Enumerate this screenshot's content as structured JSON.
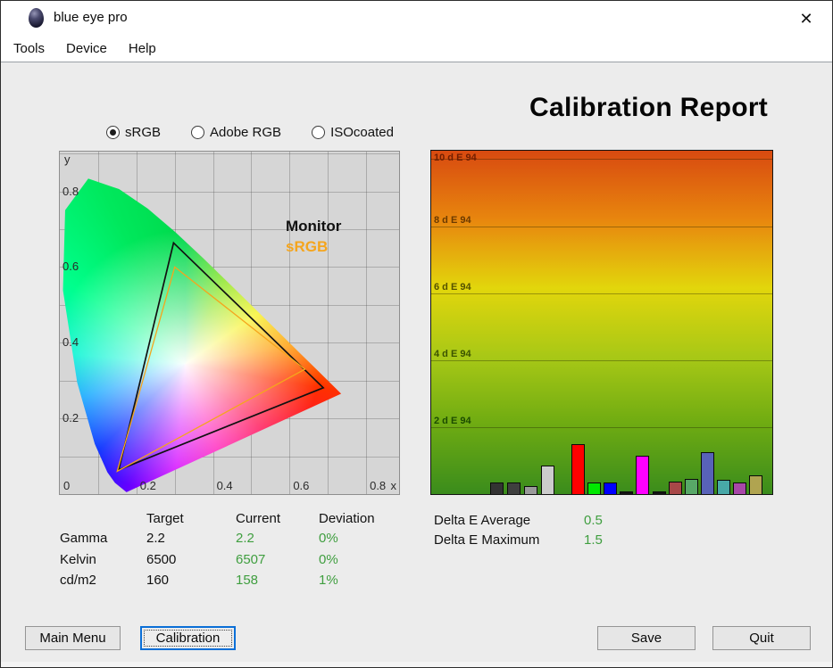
{
  "window": {
    "title": "blue eye pro",
    "close_symbol": "✕"
  },
  "menu": [
    "Tools",
    "Device",
    "Help"
  ],
  "report_title": "Calibration Report",
  "gamut_options": [
    {
      "label": "sRGB",
      "selected": true
    },
    {
      "label": "Adobe RGB",
      "selected": false
    },
    {
      "label": "ISOcoated",
      "selected": false
    }
  ],
  "cie_chart": {
    "x_axis": {
      "label": "x",
      "ticks": [
        "0",
        "0.2",
        "0.4",
        "0.6",
        "0.8"
      ],
      "max": 0.886
    },
    "y_axis": {
      "label": "y",
      "ticks": [
        "0.2",
        "0.4",
        "0.6",
        "0.8"
      ],
      "max": 0.905
    },
    "grid_step": 0.1,
    "legend": [
      {
        "label": "Monitor",
        "color": "#111111"
      },
      {
        "label": "sRGB",
        "color": "#f5a51d"
      }
    ],
    "triangles": [
      {
        "name": "Monitor",
        "color": "#111111",
        "stroke": 1.7,
        "points": [
          [
            0.297,
            0.664
          ],
          [
            0.688,
            0.281
          ],
          [
            0.154,
            0.064
          ]
        ]
      },
      {
        "name": "sRGB",
        "color": "#f5a51d",
        "stroke": 1.3,
        "points": [
          [
            0.3,
            0.6
          ],
          [
            0.64,
            0.33
          ],
          [
            0.15,
            0.06
          ]
        ]
      }
    ],
    "spectral_locus": [
      [
        0.1741,
        0.005
      ],
      [
        0.144,
        0.0297
      ],
      [
        0.1241,
        0.0578
      ],
      [
        0.0913,
        0.1327
      ],
      [
        0.0454,
        0.295
      ],
      [
        0.0082,
        0.5384
      ],
      [
        0.0139,
        0.7502
      ],
      [
        0.0743,
        0.8338
      ],
      [
        0.1547,
        0.8059
      ],
      [
        0.2296,
        0.7543
      ],
      [
        0.3016,
        0.6923
      ],
      [
        0.3731,
        0.6245
      ],
      [
        0.4441,
        0.5547
      ],
      [
        0.5125,
        0.4866
      ],
      [
        0.5752,
        0.4242
      ],
      [
        0.627,
        0.3725
      ],
      [
        0.6658,
        0.334
      ],
      [
        0.6915,
        0.3083
      ],
      [
        0.719,
        0.2809
      ],
      [
        0.7347,
        0.2653
      ]
    ]
  },
  "delta_chart": {
    "type": "bar",
    "unit_label": "d E 94",
    "scale_max": 10.25,
    "gridlines": [
      {
        "value": 10,
        "label": "10 d E 94",
        "color": "#701e00"
      },
      {
        "value": 8,
        "label": "8 d E 94",
        "color": "#6b3a00"
      },
      {
        "value": 6,
        "label": "6 d E 94",
        "color": "#565200"
      },
      {
        "value": 4,
        "label": "4 d E 94",
        "color": "#3c5400"
      },
      {
        "value": 2,
        "label": "2 d E 94",
        "color": "#1c4c00"
      }
    ],
    "gradient_stops": [
      {
        "color": "#d84a10",
        "pos": 0
      },
      {
        "color": "#e8860e",
        "pos": 20
      },
      {
        "color": "#e2d60c",
        "pos": 40
      },
      {
        "color": "#a8c816",
        "pos": 60
      },
      {
        "color": "#70ac12",
        "pos": 79
      },
      {
        "color": "#3a8c1c",
        "pos": 100
      }
    ],
    "bars": [
      {
        "value": 0.35,
        "color": "#333333"
      },
      {
        "value": 0.35,
        "color": "#3f3f3f"
      },
      {
        "value": 0.23,
        "color": "#9a9a9a"
      },
      {
        "value": 0.85,
        "color": "#cccccc"
      },
      {
        "value": 1.5,
        "color": "#ff0000"
      },
      {
        "value": 0.35,
        "color": "#00e800"
      },
      {
        "value": 0.36,
        "color": "#0000ff"
      },
      {
        "value": 0.07,
        "color": "#141414"
      },
      {
        "value": 1.15,
        "color": "#ff00ff"
      },
      {
        "value": 0.07,
        "color": "#141414"
      },
      {
        "value": 0.37,
        "color": "#a84848"
      },
      {
        "value": 0.45,
        "color": "#58a868"
      },
      {
        "value": 1.25,
        "color": "#5862b8"
      },
      {
        "value": 0.42,
        "color": "#48a8a8"
      },
      {
        "value": 0.36,
        "color": "#a848a8"
      },
      {
        "value": 0.57,
        "color": "#b0a450"
      }
    ]
  },
  "results_table": {
    "columns": [
      "Target",
      "Current",
      "Deviation"
    ],
    "value_color": "#3f9e3f",
    "rows": [
      {
        "label": "Gamma",
        "target": "2.2",
        "current": "2.2",
        "deviation": "0%"
      },
      {
        "label": "Kelvin",
        "target": "6500",
        "current": "6507",
        "deviation": "0%"
      },
      {
        "label": "cd/m2",
        "target": "160",
        "current": "158",
        "deviation": "1%"
      }
    ]
  },
  "delta_summary": [
    {
      "label": "Delta E Average",
      "value": "0.5"
    },
    {
      "label": "Delta E Maximum",
      "value": "1.5"
    }
  ],
  "action_buttons": {
    "main_menu": "Main Menu",
    "calibration": "Calibration",
    "save": "Save",
    "quit": "Quit"
  }
}
